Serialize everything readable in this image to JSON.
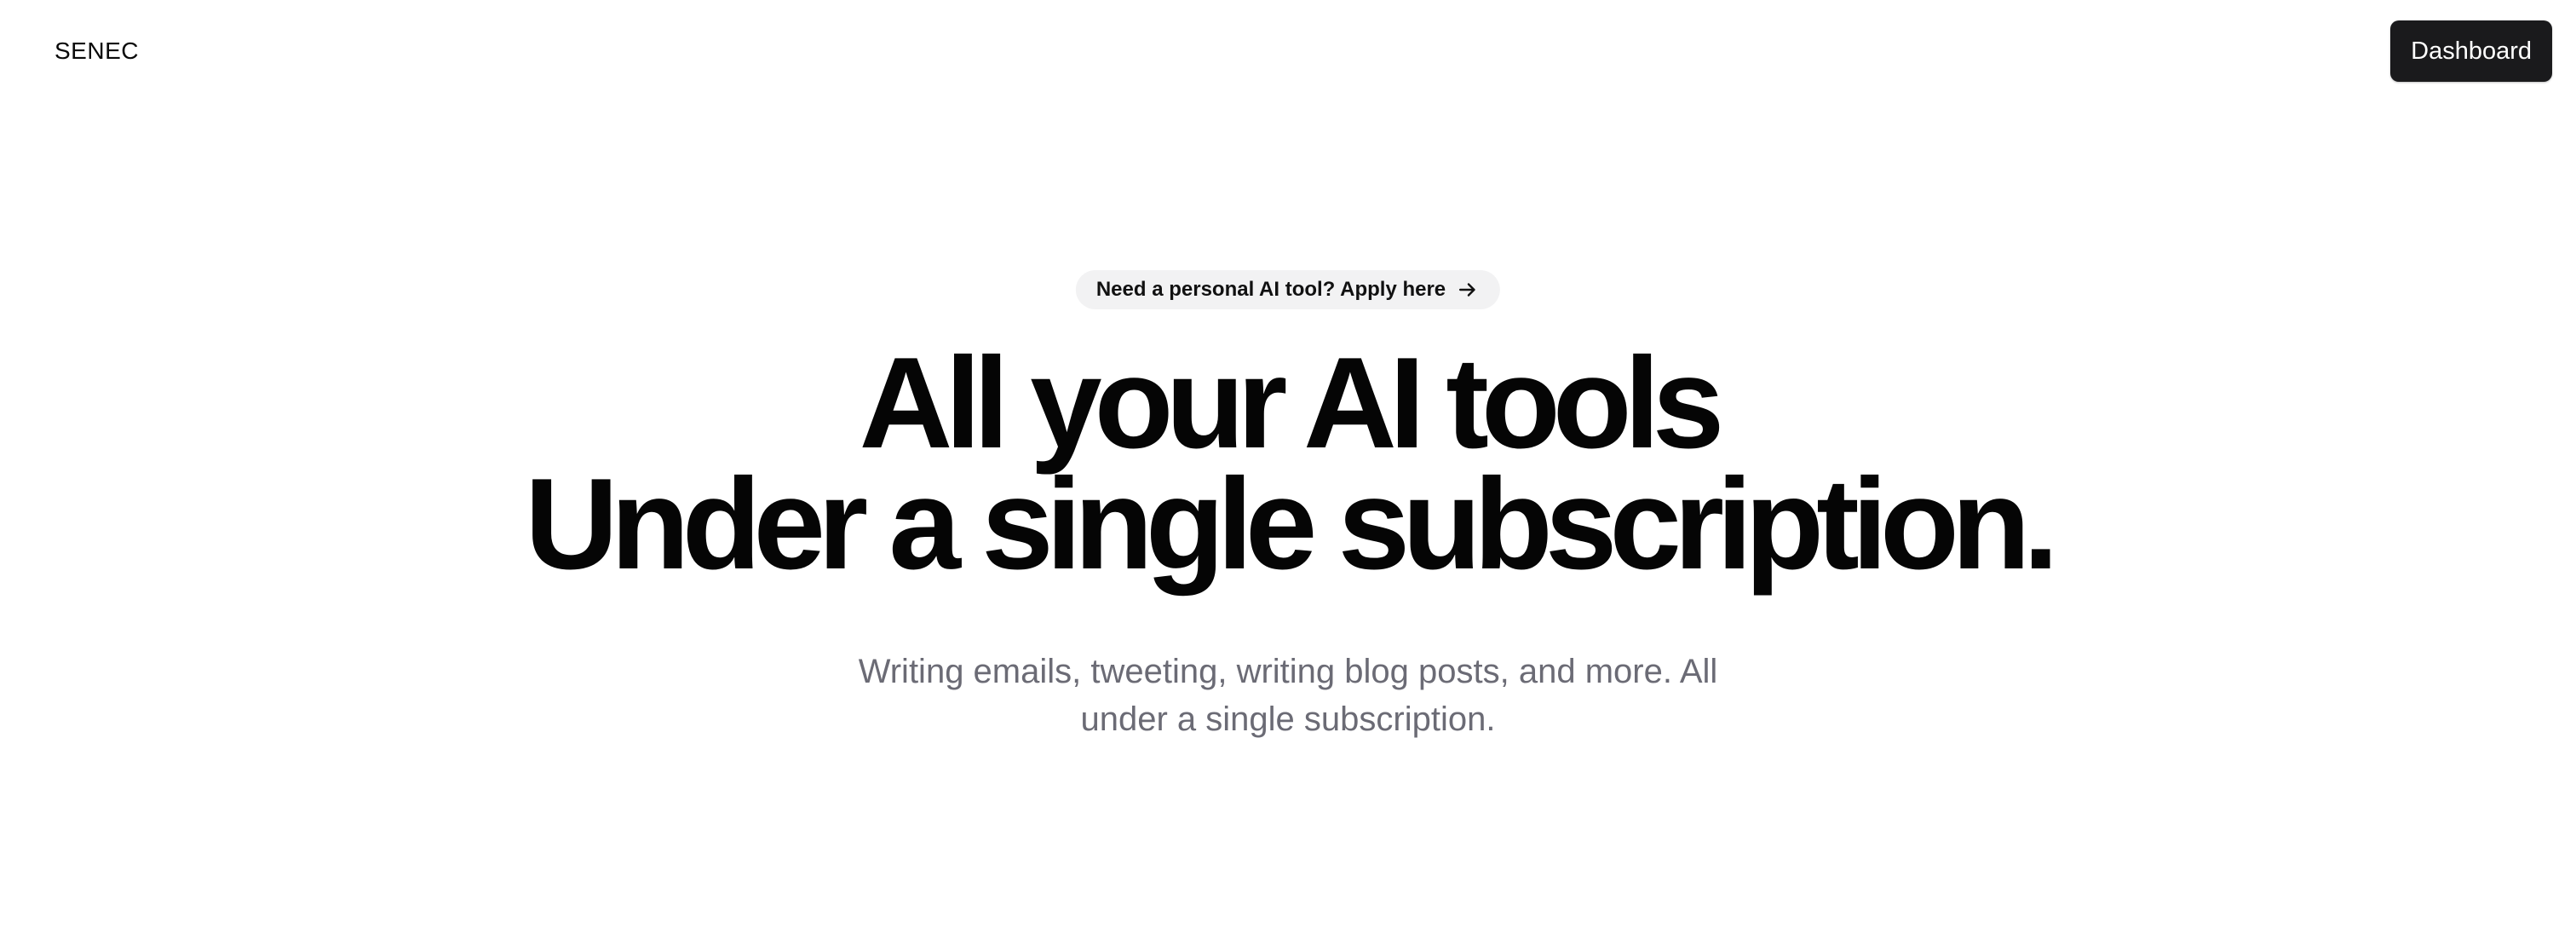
{
  "header": {
    "brand": "SENEC",
    "dashboard_label": "Dashboard"
  },
  "hero": {
    "announcement": "Need a personal AI tool? Apply here",
    "announcement_icon": "arrow-right-icon",
    "headline_line1": "All your AI tools",
    "headline_line2": "Under a single subscription.",
    "subtitle": "Writing emails, tweeting, writing blog posts, and more. All under a single subscription."
  },
  "colors": {
    "background": "#ffffff",
    "text": "#0a0a0a",
    "button_bg": "#1a1a1c",
    "pill_bg": "#f2f2f3",
    "subtitle": "#6b6b75"
  }
}
